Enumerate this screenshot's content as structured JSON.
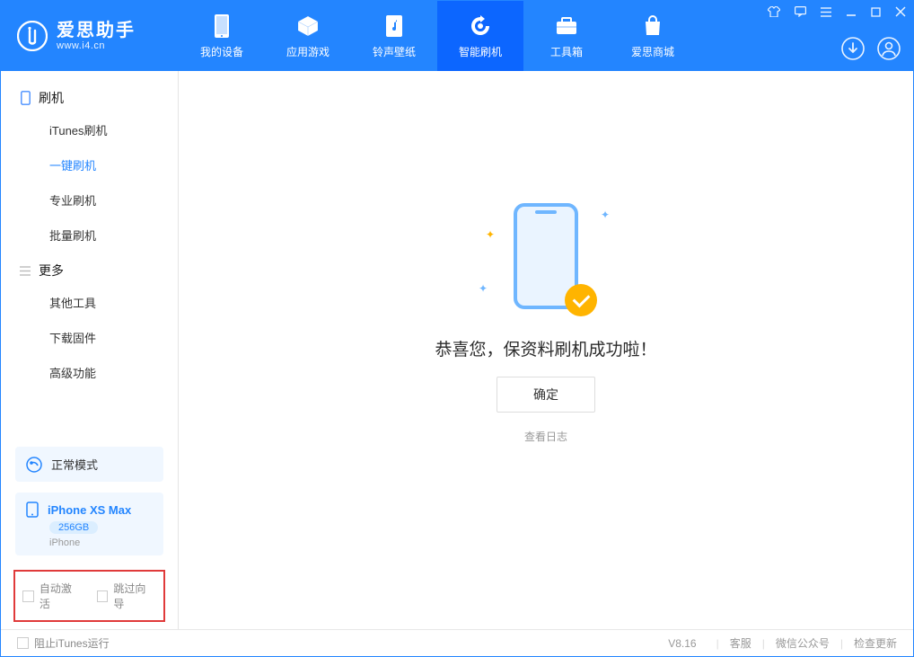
{
  "app": {
    "title": "爱思助手",
    "url": "www.i4.cn"
  },
  "nav": [
    {
      "label": "我的设备",
      "icon": "device"
    },
    {
      "label": "应用游戏",
      "icon": "cube"
    },
    {
      "label": "铃声壁纸",
      "icon": "music"
    },
    {
      "label": "智能刷机",
      "icon": "refresh",
      "active": true
    },
    {
      "label": "工具箱",
      "icon": "toolbox"
    },
    {
      "label": "爱思商城",
      "icon": "bag"
    }
  ],
  "sidebar": {
    "section1_title": "刷机",
    "section1_items": [
      "iTunes刷机",
      "一键刷机",
      "专业刷机",
      "批量刷机"
    ],
    "section1_active_index": 1,
    "section2_title": "更多",
    "section2_items": [
      "其他工具",
      "下载固件",
      "高级功能"
    ]
  },
  "mode": {
    "label": "正常模式"
  },
  "device": {
    "name": "iPhone XS Max",
    "capacity": "256GB",
    "subtype": "iPhone"
  },
  "options": {
    "auto_activate": "自动激活",
    "skip_guide": "跳过向导"
  },
  "main": {
    "success_text": "恭喜您，保资料刷机成功啦！",
    "ok_button": "确定",
    "view_log": "查看日志"
  },
  "footer": {
    "block_itunes": "阻止iTunes运行",
    "version": "V8.16",
    "links": [
      "客服",
      "微信公众号",
      "检查更新"
    ]
  }
}
